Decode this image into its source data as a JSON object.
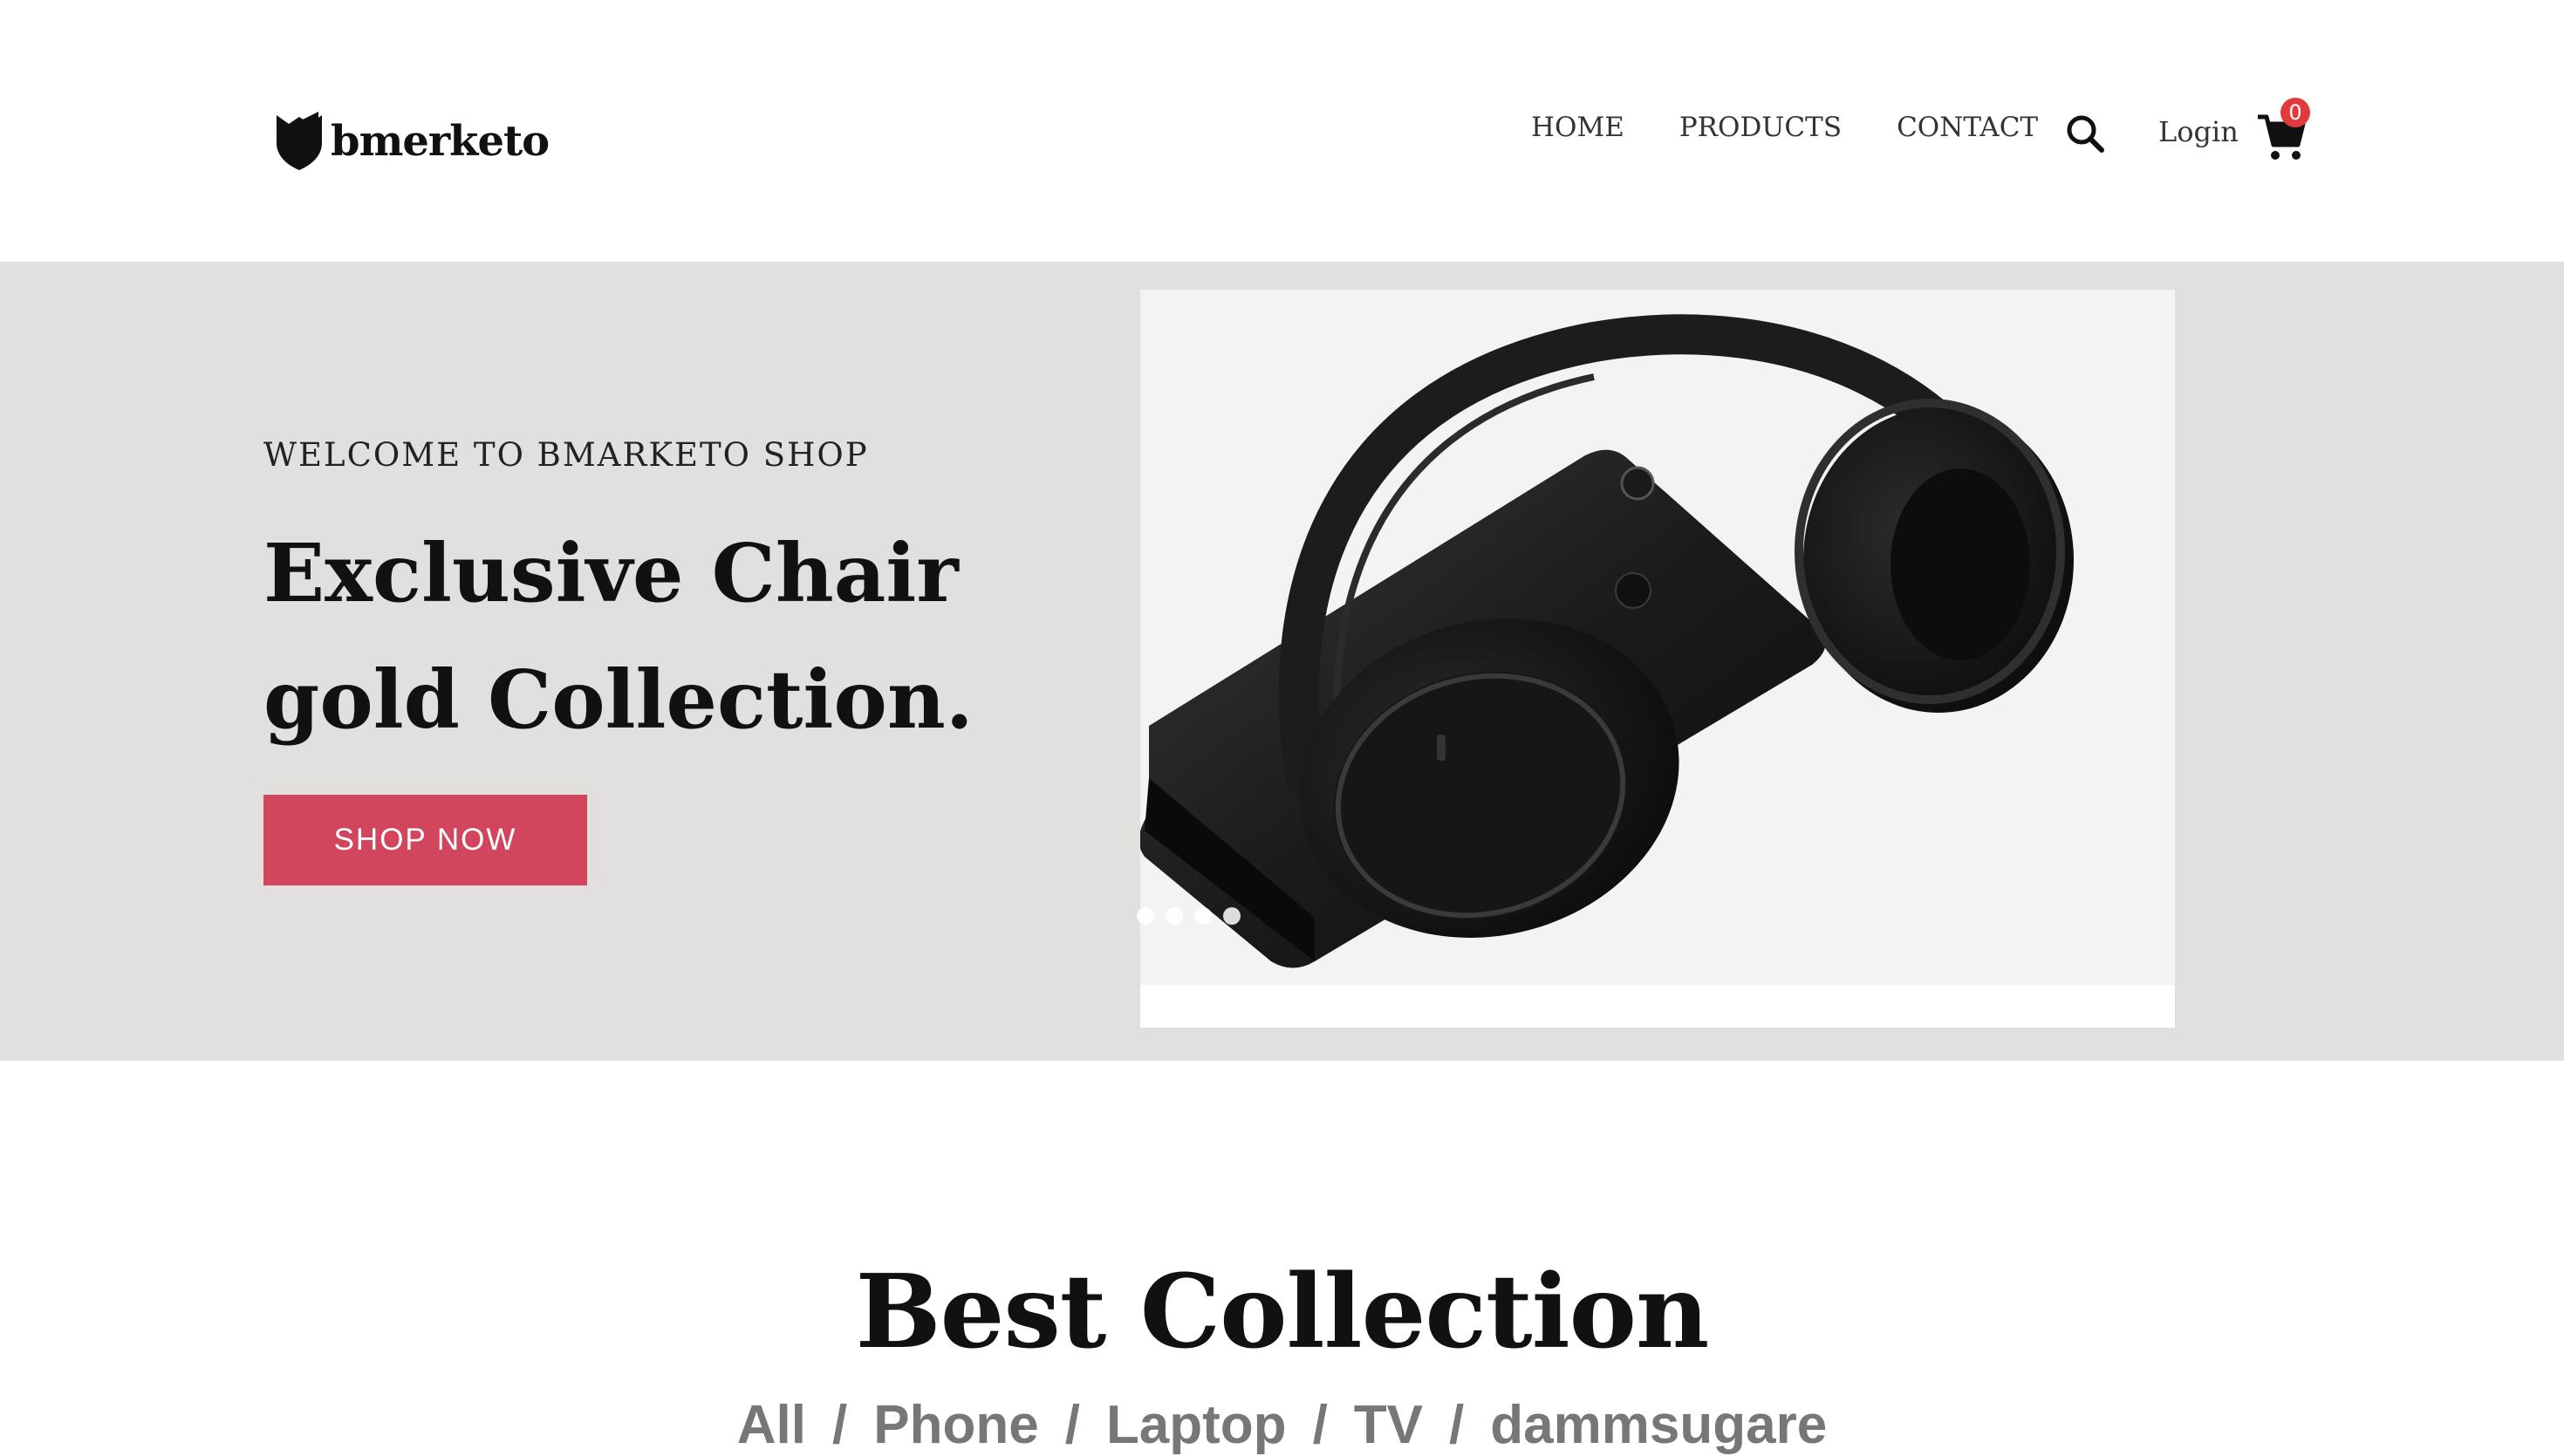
{
  "stray_char": "(",
  "brand": {
    "name": "bmerketo",
    "logo_icon": "shield-logo-icon"
  },
  "nav": {
    "items": [
      {
        "label": "HOME"
      },
      {
        "label": "PRODUCTS"
      },
      {
        "label": "CONTACT"
      }
    ],
    "search_icon": "search-icon",
    "login_label": "Login",
    "cart_icon": "cart-icon",
    "cart_count": "0"
  },
  "hero": {
    "welcome": "WELCOME TO BMARKETO SHOP",
    "headline_line1": "Exclusive Chair",
    "headline_line2": "gold Collection.",
    "cta_label": "SHOP NOW",
    "slide_count": 4
  },
  "collection": {
    "title": "Best Collection",
    "filters": [
      "All",
      "Phone",
      "Laptop",
      "TV",
      "dammsugare"
    ],
    "separator": "/"
  },
  "colors": {
    "hero_bg": "#e1e0df",
    "cta_bg": "#d1465c",
    "badge": "#e03a3a",
    "filter_text": "#777777"
  }
}
